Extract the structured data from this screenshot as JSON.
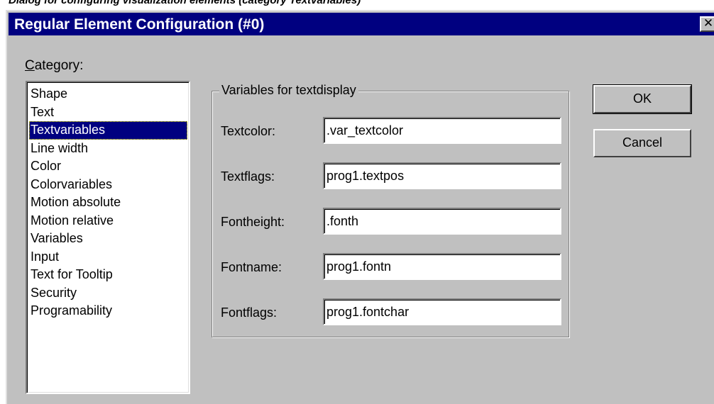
{
  "caption": "Dialog for configuring visualization elements (category Textvariables)",
  "window": {
    "title": "Regular Element Configuration (#0)",
    "close_glyph": "✕"
  },
  "category": {
    "label_accel": "C",
    "label_rest": "ategory:",
    "selected": "Textvariables",
    "items": [
      "Shape",
      "Text",
      "Textvariables",
      "Line width",
      "Color",
      "Colorvariables",
      "Motion absolute",
      "Motion relative",
      "Variables",
      "Input",
      "Text for Tooltip",
      "Security",
      "Programability"
    ]
  },
  "group": {
    "title": "Variables for textdisplay",
    "fields": [
      {
        "label": "Textcolor:",
        "value": ".var_textcolor"
      },
      {
        "label": "Textflags:",
        "value": "prog1.textpos"
      },
      {
        "label": "Fontheight:",
        "value": ".fonth"
      },
      {
        "label": "Fontname:",
        "value": "prog1.fontn"
      },
      {
        "label": "Fontflags:",
        "value": "prog1.fontchar"
      }
    ]
  },
  "buttons": {
    "ok": "OK",
    "cancel": "Cancel"
  },
  "colors": {
    "titlebar": "#000080",
    "face": "#c0c0c0",
    "selection": "#000080"
  },
  "icons": {
    "close": "close-icon"
  }
}
